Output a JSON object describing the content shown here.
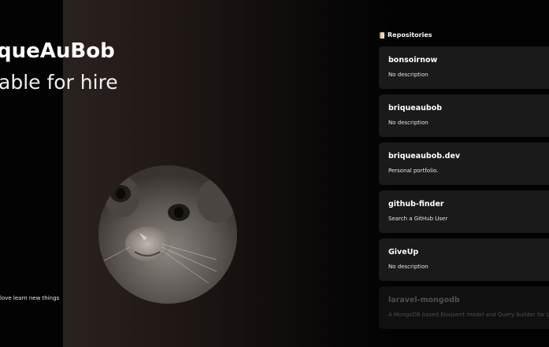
{
  "hero": {
    "name_partial": "queAuBob",
    "status_partial": "able for hire",
    "tagline_partial": "love learn new things"
  },
  "repositories": {
    "header": "Repositories",
    "icon": "book-icon",
    "items": [
      {
        "name": "bonsoirnow",
        "description": "No description"
      },
      {
        "name": "briqueaubob",
        "description": "No description"
      },
      {
        "name": "briqueaubob.dev",
        "description": "Personal portfolio."
      },
      {
        "name": "github-finder",
        "description": "Search a GitHub User"
      },
      {
        "name": "GiveUp",
        "description": "No description"
      },
      {
        "name": "laravel-mongodb",
        "description": "A MongoDB based Eloquent model and Query builder for Lara"
      }
    ]
  },
  "colors": {
    "background": "#030303",
    "card": "#1a1a1a",
    "card_faded": "#101010"
  }
}
